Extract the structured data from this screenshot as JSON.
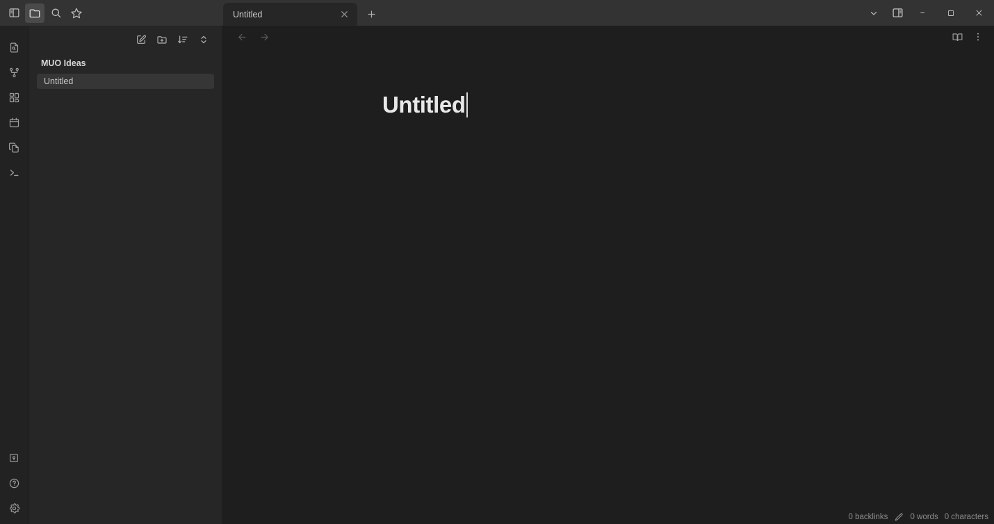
{
  "titlebar": {
    "left_icons": [
      {
        "name": "toggle-left-sidebar-icon",
        "label": "Toggle left sidebar",
        "active": false
      },
      {
        "name": "folder-icon",
        "label": "Files",
        "active": true
      },
      {
        "name": "search-icon",
        "label": "Search",
        "active": false
      },
      {
        "name": "star-icon",
        "label": "Bookmarks",
        "active": false
      }
    ],
    "tabs": [
      {
        "label": "Untitled",
        "active": true,
        "close_label": "Close tab"
      }
    ],
    "new_tab_label": "New tab",
    "window_controls": [
      {
        "name": "chevron-down-icon",
        "label": "More options"
      },
      {
        "name": "toggle-right-sidebar-icon",
        "label": "Toggle right sidebar"
      },
      {
        "name": "minimize-icon",
        "label": "Minimize"
      },
      {
        "name": "maximize-icon",
        "label": "Maximize"
      },
      {
        "name": "close-icon",
        "label": "Close"
      }
    ]
  },
  "ribbon": {
    "top_items": [
      {
        "name": "open-quick-switcher-icon",
        "label": "Quick switcher"
      },
      {
        "name": "graph-view-icon",
        "label": "Graph view"
      },
      {
        "name": "canvas-icon",
        "label": "Canvas"
      },
      {
        "name": "daily-note-icon",
        "label": "Daily note"
      },
      {
        "name": "templates-icon",
        "label": "Insert template"
      },
      {
        "name": "terminal-icon",
        "label": "Command palette"
      }
    ],
    "bottom_items": [
      {
        "name": "vault-icon",
        "label": "Open another vault"
      },
      {
        "name": "help-icon",
        "label": "Help"
      },
      {
        "name": "settings-icon",
        "label": "Settings"
      }
    ]
  },
  "sidebar": {
    "toolbar": [
      {
        "name": "new-note-icon",
        "label": "New note"
      },
      {
        "name": "new-folder-icon",
        "label": "New folder"
      },
      {
        "name": "sort-icon",
        "label": "Change sort order"
      },
      {
        "name": "collapse-expand-icon",
        "label": "Expand all"
      }
    ],
    "tree": {
      "folder_label": "MUO Ideas",
      "files": [
        {
          "label": "Untitled",
          "selected": true
        }
      ]
    }
  },
  "editor": {
    "nav": {
      "back_label": "Navigate back",
      "forward_label": "Navigate forward"
    },
    "actions": [
      {
        "name": "reading-view-icon",
        "label": "Open reading view"
      },
      {
        "name": "more-options-icon",
        "label": "More options"
      }
    ],
    "document": {
      "title": "Untitled"
    }
  },
  "statusbar": {
    "backlinks": "0 backlinks",
    "edit_icon_label": "Editing mode",
    "words": "0 words",
    "characters": "0 characters"
  },
  "colors": {
    "titlebar_bg": "#333333",
    "ribbon_bg": "#222222",
    "sidebar_bg": "#262626",
    "editor_bg": "#1e1e1e",
    "selected_item_bg": "#363636",
    "text_primary": "#e8e8e8",
    "text_muted": "#8d8d8d"
  }
}
